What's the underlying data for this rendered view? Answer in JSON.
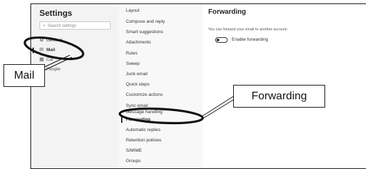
{
  "settings": {
    "title": "Settings",
    "search_placeholder": "Search settings",
    "nav": {
      "general": "General",
      "mail": "Mail",
      "partial1": "Cal",
      "partial2": "People"
    }
  },
  "mail_menu": [
    "Layout",
    "Compose and reply",
    "Smart suggestions",
    "Attachments",
    "Rules",
    "Sweep",
    "Junk email",
    "Quick steps",
    "Customize actions",
    "Sync email",
    "Message handling",
    "Forwarding",
    "Automatic replies",
    "Retention policies",
    "S/MIME",
    "Groups"
  ],
  "content": {
    "title": "Forwarding",
    "description": "You can forward your email to another account.",
    "toggle_label": "Enable forwarding",
    "toggle_on": false
  },
  "annotations": {
    "mail_label": "Mail",
    "forwarding_label": "Forwarding"
  },
  "icons": {
    "search": "search-icon",
    "general": "gear-icon",
    "mail": "mail-icon"
  }
}
